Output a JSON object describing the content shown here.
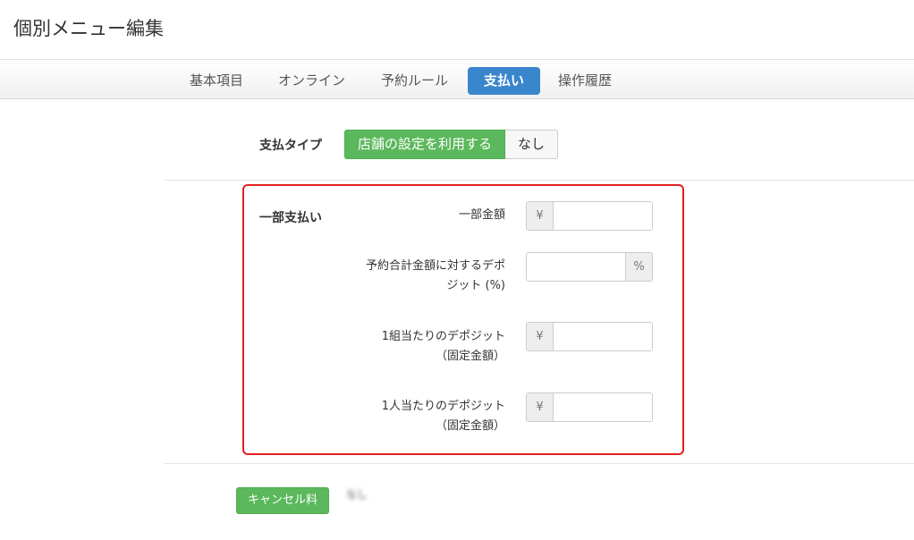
{
  "page": {
    "title": "個別メニュー編集"
  },
  "tabs": [
    {
      "label": "基本項目"
    },
    {
      "label": "オンライン"
    },
    {
      "label": "予約ルール"
    },
    {
      "label": "支払い"
    },
    {
      "label": "操作履歴"
    }
  ],
  "active_tab": "支払い",
  "payment_type": {
    "label": "支払タイプ",
    "options": [
      "店舗の設定を利用する",
      "なし"
    ],
    "selected": "店舗の設定を利用する"
  },
  "partial_payment": {
    "section_label": "一部支払い",
    "fields": [
      {
        "label_lines": [
          "一部金額"
        ],
        "addon": "¥",
        "addon_side": "left",
        "value": ""
      },
      {
        "label_lines": [
          "予約合計金額に対するデポ",
          "ジット (%)"
        ],
        "addon": "%",
        "addon_side": "right",
        "value": ""
      },
      {
        "label_lines": [
          "1組当たりのデポジット",
          "（固定金額）"
        ],
        "addon": "¥",
        "addon_side": "left",
        "value": ""
      },
      {
        "label_lines": [
          "1人当たりのデポジット",
          "（固定金額）"
        ],
        "addon": "¥",
        "addon_side": "left",
        "value": ""
      }
    ]
  },
  "cancel_fee": {
    "button_label": "キャンセル料",
    "status_text": "なし"
  },
  "colors": {
    "primary": "#3a86cc",
    "success": "#5cb85c",
    "highlight_border": "#e0201e"
  }
}
